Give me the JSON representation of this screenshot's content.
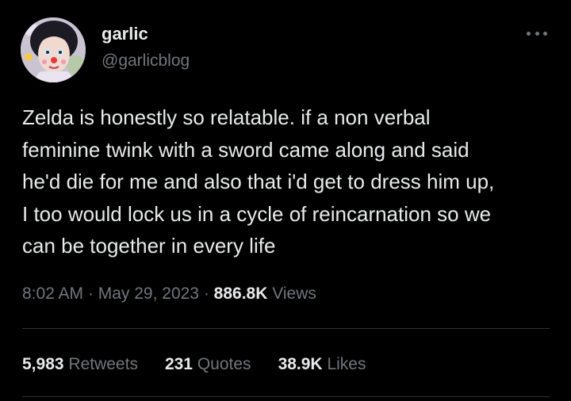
{
  "author": {
    "display_name": "garlic",
    "handle": "@garlicblog",
    "avatar_icon": "profile-photo"
  },
  "menu": {
    "icon": "more-horizontal-icon"
  },
  "tweet": {
    "text": "Zelda is honestly so relatable. if a non verbal\nfeminine twink with a sword came along and said\nhe'd die for me and also that i'd get to dress him up,\nI too would lock us in a cycle of reincarnation so we\ncan be together in every life"
  },
  "meta": {
    "time": "8:02 AM",
    "separator": " · ",
    "date": "May 29, 2023",
    "views_count": "886.8K",
    "views_label": "Views"
  },
  "stats": {
    "retweets_count": "5,983",
    "retweets_label": "Retweets",
    "quotes_count": "231",
    "quotes_label": "Quotes",
    "likes_count": "38.9K",
    "likes_label": "Likes"
  },
  "colors": {
    "background": "#000000",
    "primary_text": "#e7e9ea",
    "secondary_text": "#71767b",
    "divider": "#2f3336"
  }
}
